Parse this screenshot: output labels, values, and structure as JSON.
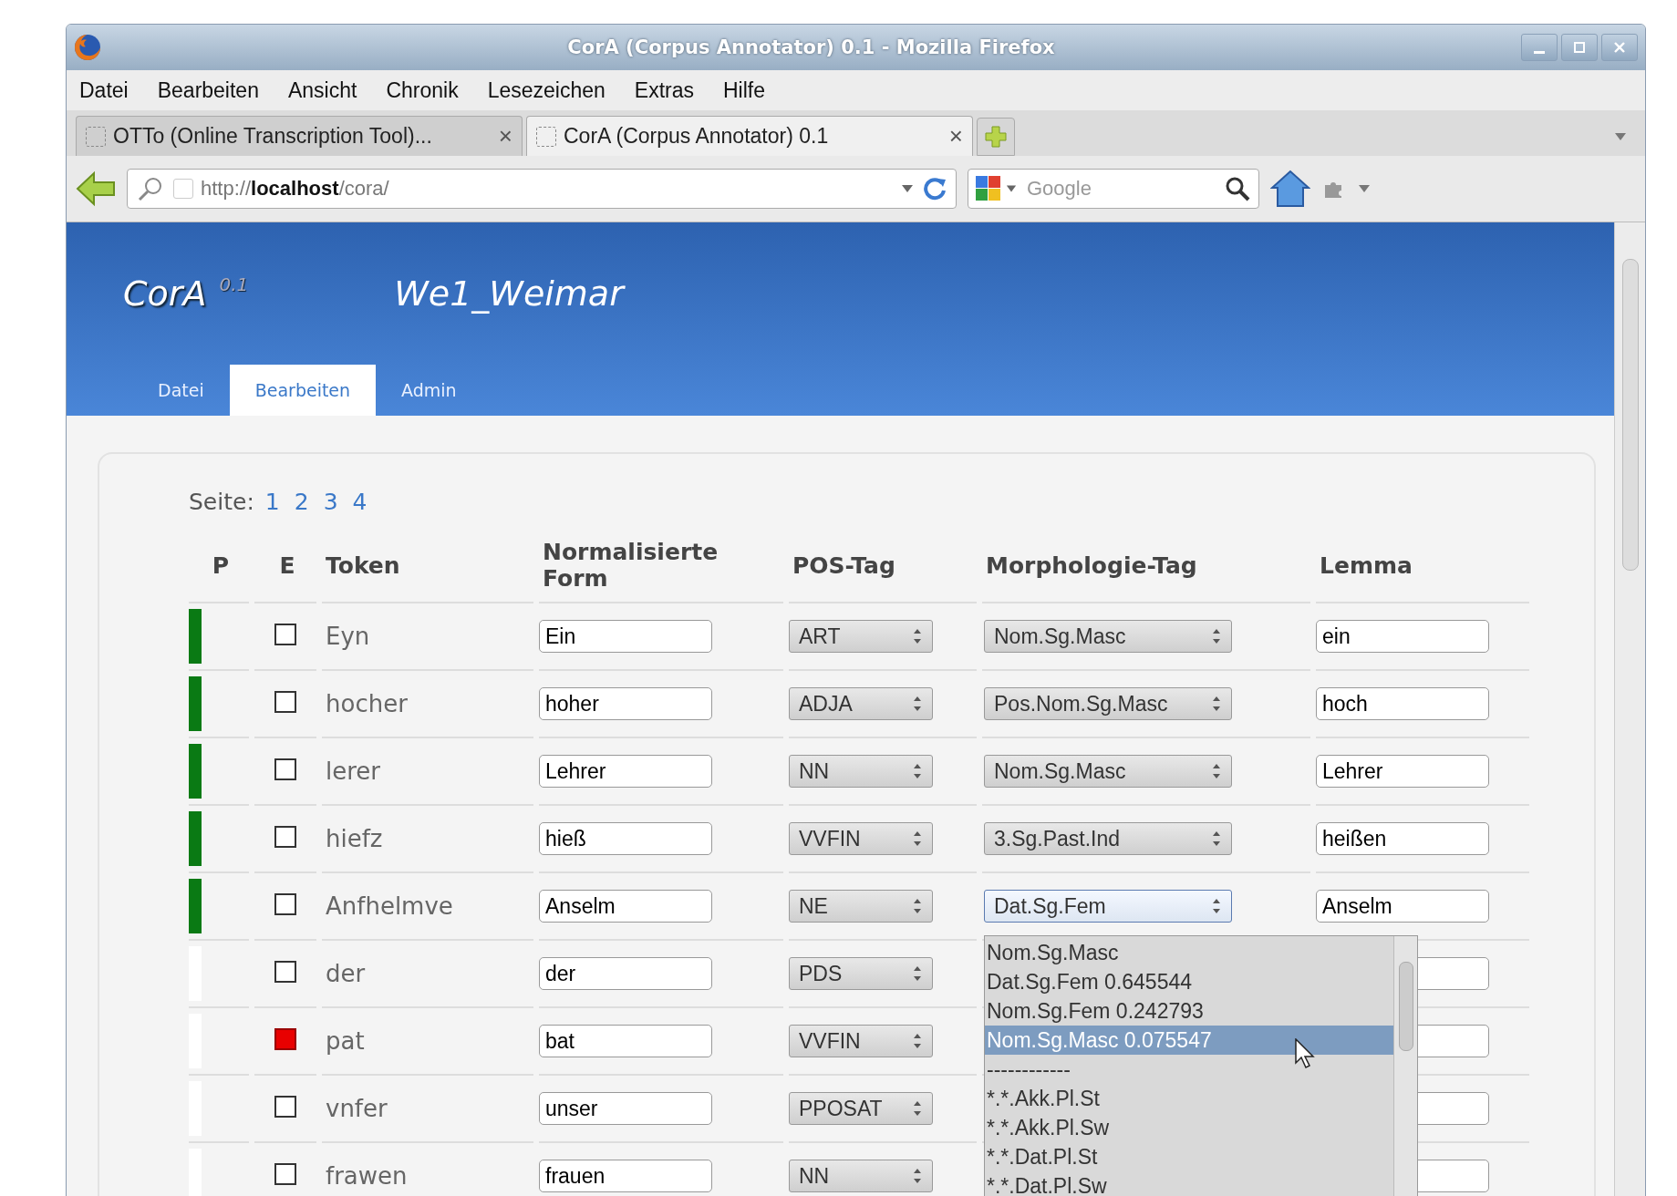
{
  "window": {
    "title": "CorA (Corpus Annotator) 0.1 - Mozilla Firefox"
  },
  "menu": [
    "Datei",
    "Bearbeiten",
    "Ansicht",
    "Chronik",
    "Lesezeichen",
    "Extras",
    "Hilfe"
  ],
  "browser_tabs": [
    {
      "label": "OTTo (Online Transcription Tool)...",
      "close": "×",
      "selected": false
    },
    {
      "label": "CorA (Corpus Annotator) 0.1",
      "close": "×",
      "selected": true
    }
  ],
  "address_bar": {
    "value": "http://**localhost**/cora/"
  },
  "search": {
    "placeholder": "Google"
  },
  "app": {
    "logo": "CorA",
    "version": "0.1",
    "document": "We1_Weimar"
  },
  "app_tabs": [
    {
      "label": "Datei",
      "selected": false
    },
    {
      "label": "Bearbeiten",
      "selected": true
    },
    {
      "label": "Admin",
      "selected": false
    }
  ],
  "pager": {
    "label": "Seite:",
    "pages": [
      "1",
      "2",
      "3",
      "4"
    ]
  },
  "table": {
    "columns": [
      "P",
      "E",
      "Token",
      "Normalisierte Form",
      "POS-Tag",
      "Morphologie-Tag",
      "Lemma"
    ],
    "rows": [
      {
        "progress": true,
        "error": false,
        "token": "Eyn",
        "norm": "Ein",
        "pos": "ART",
        "morph": "Nom.Sg.Masc",
        "lemma": "ein"
      },
      {
        "progress": true,
        "error": false,
        "token": "hocher",
        "norm": "hoher",
        "pos": "ADJA",
        "morph": "Pos.Nom.Sg.Masc",
        "lemma": "hoch"
      },
      {
        "progress": true,
        "error": false,
        "token": "lerer",
        "norm": "Lehrer",
        "pos": "NN",
        "morph": "Nom.Sg.Masc",
        "lemma": "Lehrer"
      },
      {
        "progress": true,
        "error": false,
        "token": "hiefz",
        "norm": "hieß",
        "pos": "VVFIN",
        "morph": "3.Sg.Past.Ind",
        "lemma": "heißen"
      },
      {
        "progress": true,
        "error": false,
        "token": "Anfhelmve",
        "norm": "Anselm",
        "pos": "NE",
        "morph": "Dat.Sg.Fem",
        "lemma": "Anselm",
        "expanded": true,
        "options": [
          {
            "label": "Nom.Sg.Masc",
            "selected": false
          },
          {
            "label": "Dat.Sg.Fem 0.645544",
            "selected": false
          },
          {
            "label": "Nom.Sg.Fem 0.242793",
            "selected": false
          },
          {
            "label": "Nom.Sg.Masc 0.075547",
            "selected": true
          },
          {
            "label": "------------",
            "selected": false
          },
          {
            "label": "*.*.Akk.Pl.St",
            "selected": false
          },
          {
            "label": "*.*.Akk.Pl.Sw",
            "selected": false
          },
          {
            "label": "*.*.Dat.Pl.St",
            "selected": false
          },
          {
            "label": "*.*.Dat.Pl.Sw",
            "selected": false
          }
        ]
      },
      {
        "progress": false,
        "error": false,
        "token": "der",
        "norm": "der",
        "pos": "PDS"
      },
      {
        "progress": false,
        "error": true,
        "token": "pat",
        "norm": "bat",
        "pos": "VVFIN"
      },
      {
        "progress": false,
        "error": false,
        "token": "vnfer",
        "norm": "unser",
        "pos": "PPOSAT"
      },
      {
        "progress": false,
        "error": false,
        "token": "frawen",
        "norm": "frauen",
        "pos": "NN"
      }
    ]
  }
}
